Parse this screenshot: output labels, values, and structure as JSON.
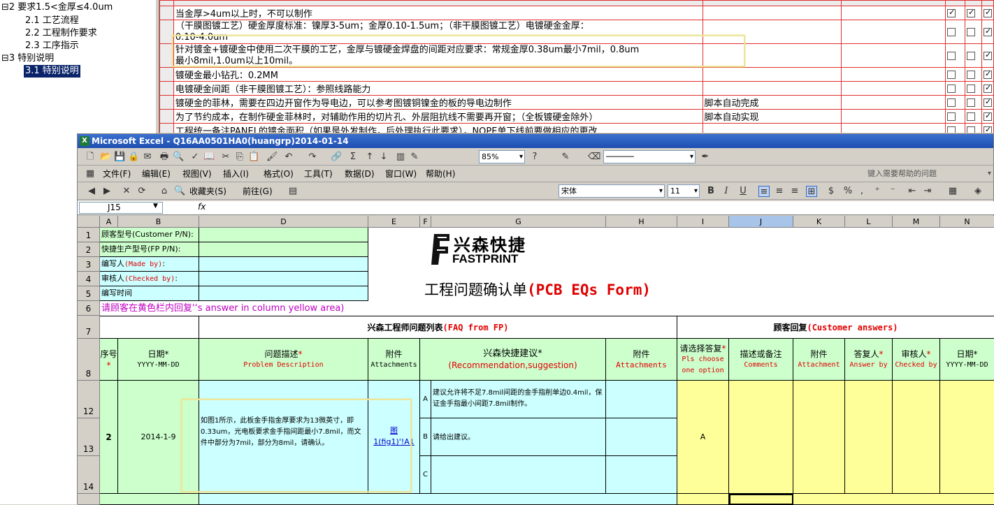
{
  "tree": [
    {
      "label": "2 要求1.5<金厚≤4.0um",
      "prefix": "⊟"
    },
    {
      "label": "2.1 工艺流程"
    },
    {
      "label": "2.2 工程制作要求"
    },
    {
      "label": "2.3 工序指示"
    },
    {
      "label": "3 特别说明",
      "prefix": "⊟"
    },
    {
      "label": "3.1 特别说明",
      "selected": true
    }
  ],
  "bg_rows": [
    {
      "text": "当金厚>4um以上时，不可以制作",
      "note": "",
      "c1": true,
      "c2": true,
      "c3": true
    },
    {
      "text": "（干膜图镀工艺）硬金厚度标准：镍厚3-5um；金厚0.10-1.5um；（非干膜图镀工艺）电镀硬金金厚：",
      "text2": "0.10-4.0um",
      "note": "",
      "c1": false,
      "c2": false,
      "c3": true
    },
    {
      "text": "针对镀金+镀硬金中使用二次干膜的工艺，金厚与镀硬金焊盘的间距对应要求：常规金厚0.38um最小7mil，0.8um",
      "text2": "最小8mil,1.0um以上10mil。",
      "note": "",
      "c1": false,
      "c2": false,
      "c3": true
    },
    {
      "text": "镀硬金最小钻孔：0.2MM",
      "note": "",
      "c1": false,
      "c2": false,
      "c3": true
    },
    {
      "text": "电镀硬金间距（非干膜图镀工艺）：参照线路能力",
      "note": "",
      "c1": false,
      "c2": false,
      "c3": true
    },
    {
      "text": "镀硬金的菲林，需要在四边开窗作为导电边，可以参考图镀铜镍金的板的导电边制作",
      "note": "脚本自动完成",
      "c1": false,
      "c2": false,
      "c3": true
    },
    {
      "text": "为了节约成本，在制作硬金菲林时，对辅助作用的切片孔、外层阻抗线不需要再开窗；（全板镀硬金除外）",
      "note": "脚本自动实现",
      "c1": false,
      "c2": false,
      "c3": true
    },
    {
      "text": "工程统一备注PANEL的镀金面积（如果是外发制作，后处理执行此要求），NOPE单下线前要做相应的更改",
      "note": "",
      "c1": false,
      "c2": false,
      "c3": true
    }
  ],
  "excel": {
    "title": "Microsoft Excel - Q16AA0501HA0(huangrp)2014-01-14",
    "menu": [
      "文件(F)",
      "编辑(E)",
      "视图(V)",
      "插入(I)",
      "格式(O)",
      "工具(T)",
      "数据(D)",
      "窗口(W)",
      "帮助(H)"
    ],
    "help_placeholder": "键入需要帮助的问题",
    "zoom": "85%",
    "font": "宋体",
    "font_size": "11",
    "favorites": "收藏夹(S)",
    "goto": "前往(G)",
    "namebox": "J15",
    "fx": "fx",
    "columns": [
      "A",
      "B",
      "D",
      "E",
      "F",
      "G",
      "H",
      "I",
      "J",
      "K",
      "L",
      "M",
      "N"
    ],
    "rows": [
      "1",
      "2",
      "3",
      "4",
      "5",
      "6",
      "7",
      "8",
      "12",
      "13",
      "14"
    ],
    "labels": {
      "customer_pn": "顾客型号(Customer P/N):",
      "fp_pn": "快捷生产型号(FP P/N):",
      "made_by_a": "编写人",
      "made_by_b": "(Made by)",
      "made_by_c": ":",
      "checked_a": "审核人",
      "checked_b": "(Checked by)",
      "checked_c": ":",
      "time": "编写时间",
      "instruction": "请顾客在黄色栏内回复'‘s answer in column yellow area)"
    },
    "logo": {
      "cn": "兴森快捷",
      "en": "FASTPRINT"
    },
    "form_title_cn": "工程问题确认单",
    "form_title_en": "(PCB EQs Form)",
    "sec_fp_cn": "兴森工程师问题列表",
    "sec_fp_en": "(FAQ from FP)",
    "sec_cust_cn": "顾客回复",
    "sec_cust_en": "(Customer answers)",
    "headers": {
      "no": "序号",
      "date": "日期*",
      "date_fmt": "YYYY-MM-DD",
      "desc": "问题描述",
      "desc_en": "Problem Description",
      "att": "附件",
      "att_en": "Attachments",
      "rec": "兴森快捷建议*",
      "rec_en": "(Recommendation,suggestion)",
      "att2": "附件",
      "att2_en": "Attachments",
      "choose": "请选择答复",
      "choose_en": "Pls choose one option",
      "comments": "描述或备注",
      "comments_en": "Comments",
      "att3": "附件",
      "att3_en": "Attachment",
      "answer": "答复人",
      "answer_en": "Answer by",
      "checker": "审核人",
      "checker_en": "Checked by",
      "date2": "日期*",
      "date2_fmt": "YYYY-MM-DD"
    },
    "entry": {
      "no": "2",
      "date": "2014-1-9",
      "desc": "如图1所示，此板金手指金厚要求为13微英寸，即0.33um，光电板要求金手指间距最小7.8mil，而文件中部分为7mil，部分为8mil，请确认。",
      "attach": "图1(fig1)'!A1",
      "opt_a": "建议允许将不足7.8mil间距的金手指削单边0.4mil，保证金手指最小间距7.8mil制作。",
      "opt_b": "请给出建议。",
      "opt_c": "",
      "answer": "A"
    }
  }
}
